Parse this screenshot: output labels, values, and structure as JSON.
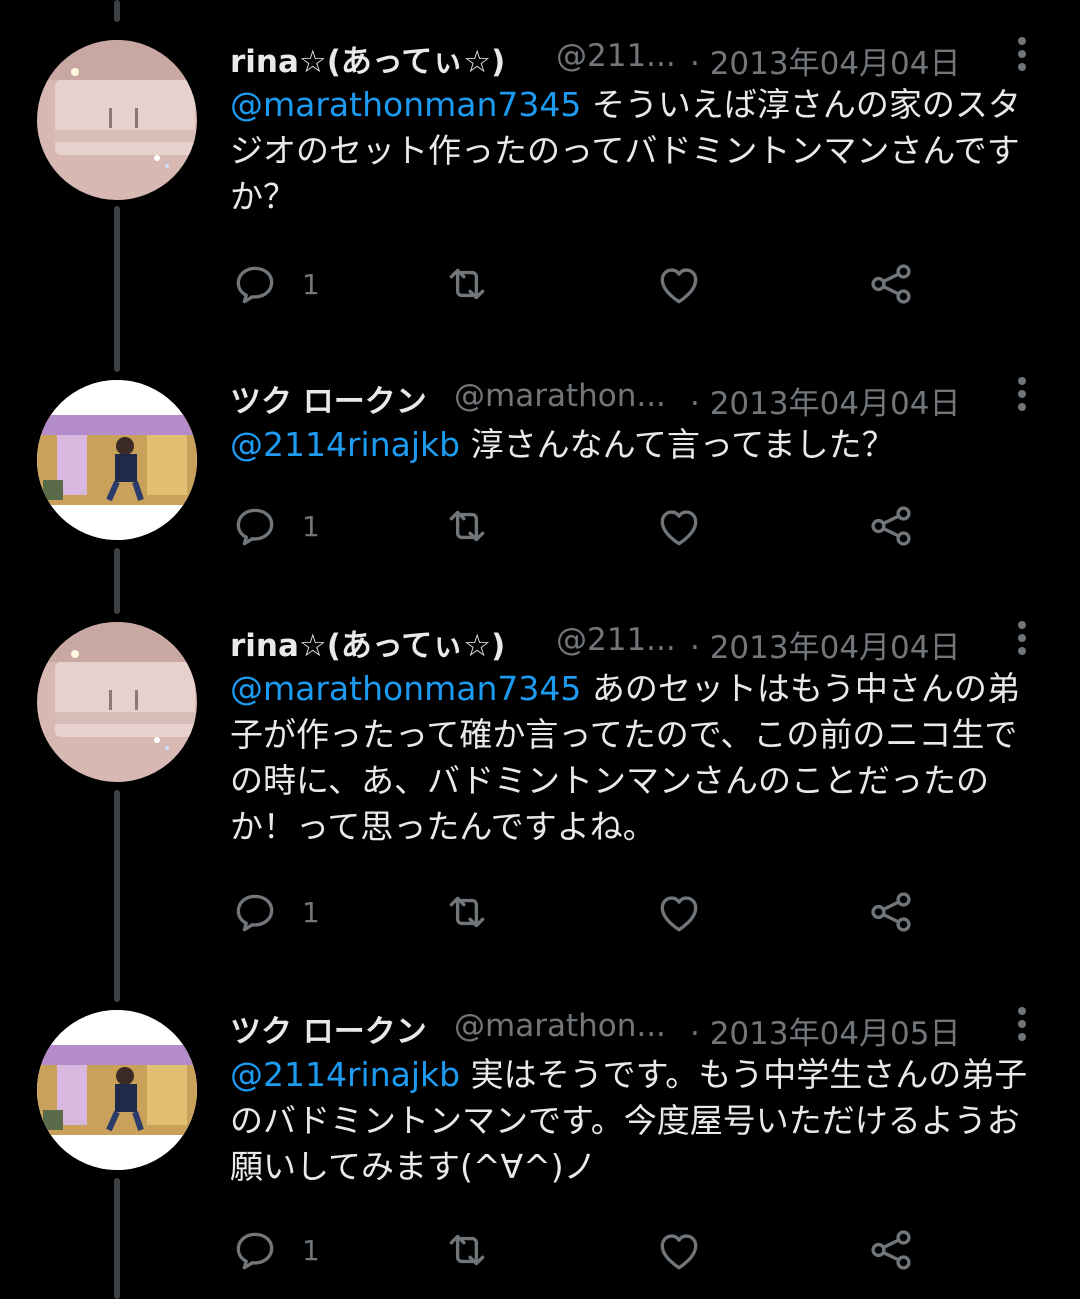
{
  "colors": {
    "background": "#000000",
    "text": "#e7e9ea",
    "secondary": "#71767b",
    "mention": "#1d9bf0",
    "thread_line": "#3e4144"
  },
  "icons": {
    "reply": "reply-icon",
    "retweet": "retweet-icon",
    "like": "like-icon",
    "share": "share-icon",
    "more": "more-icon"
  },
  "tweets": [
    {
      "name": "rina☆(あってぃ☆)",
      "handle": "@211...",
      "date": "· 2013年04月04日",
      "mention": "@marathonman7345",
      "text_line1": " そういえば淳さんの家のスタ",
      "text_rest": "ジオのセット作ったのってバドミントンマンさんですか？",
      "reply_count": "1"
    },
    {
      "name": "ツク ロークン",
      "handle": "@marathon...",
      "date": "· 2013年04月04日",
      "mention": "@2114rinajkb",
      "text_line1": " 淳さんなんて言ってました？",
      "text_rest": "",
      "reply_count": "1"
    },
    {
      "name": "rina☆(あってぃ☆)",
      "handle": "@211...",
      "date": "· 2013年04月04日",
      "mention": "@marathonman7345",
      "text_line1": " あのセットはもう中さんの弟",
      "text_rest": "子が作ったって確か言ってたので、この前のニコ生での時に、あ、バドミントンマンさんのことだったのか！って思ったんですよね。",
      "reply_count": "1"
    },
    {
      "name": "ツク ロークン",
      "handle": "@marathon...",
      "date": "· 2013年04月05日",
      "mention": "@2114rinajkb",
      "text_line1": " 実はそうです。もう中学生さんの弟子",
      "text_rest": "のバドミントンマンです。今度屋号いただけるようお願いしてみます(^∀^)ノ",
      "reply_count": "1"
    }
  ]
}
